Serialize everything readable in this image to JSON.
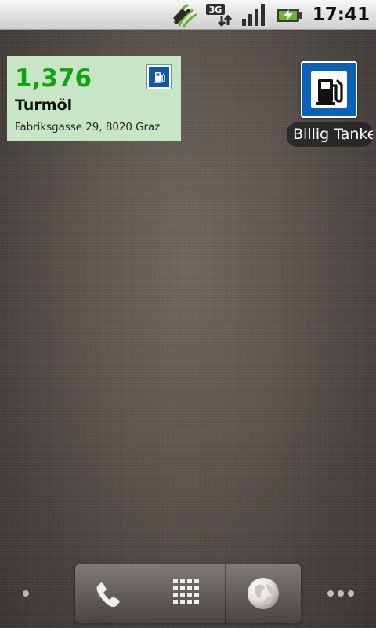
{
  "status_bar": {
    "time": "17:41",
    "network_type": "3G",
    "icons": [
      "location-icon",
      "network-3g-icon",
      "signal-icon",
      "battery-charging-icon"
    ]
  },
  "fuel_widget": {
    "price": "1,376",
    "station": "Turmöl",
    "address": "Fabriksgasse 29, 8020 Graz",
    "price_color": "#10a510",
    "background_color": "#c8e6c7",
    "icon": "fuel-pump-icon"
  },
  "app_shortcut": {
    "label": "Billig Tanke",
    "icon": "fuel-pump-icon",
    "icon_color": "#0b61b5"
  },
  "dock": {
    "items": [
      {
        "name": "phone-button",
        "icon": "phone-icon"
      },
      {
        "name": "app-drawer-button",
        "icon": "grid-icon"
      },
      {
        "name": "browser-button",
        "icon": "globe-icon"
      }
    ]
  },
  "page_indicators": {
    "left": "single-dot",
    "right": "three-dots"
  }
}
